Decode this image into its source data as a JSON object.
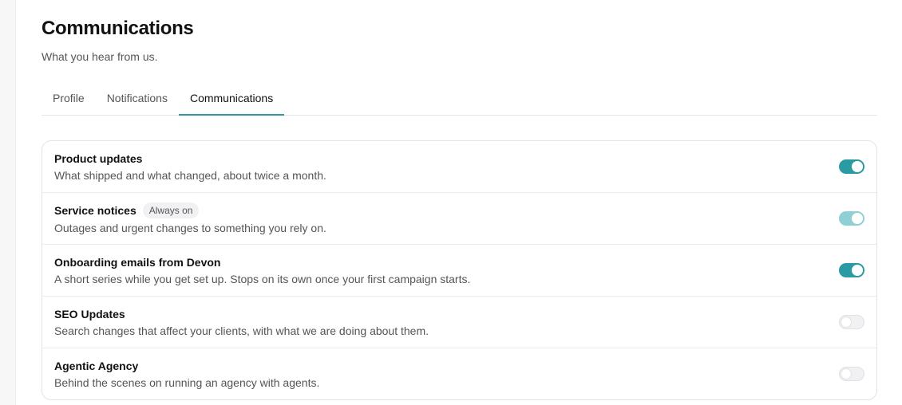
{
  "page": {
    "title": "Communications",
    "subtitle": "What you hear from us."
  },
  "tabs": [
    {
      "label": "Profile",
      "active": false
    },
    {
      "label": "Notifications",
      "active": false
    },
    {
      "label": "Communications",
      "active": true
    }
  ],
  "preferences": [
    {
      "title": "Product updates",
      "description": "What shipped and what changed, about twice a month.",
      "enabled": true,
      "locked": false
    },
    {
      "title": "Service notices",
      "badge": "Always on",
      "description": "Outages and urgent changes to something you rely on.",
      "enabled": true,
      "locked": true
    },
    {
      "title": "Onboarding emails from Devon",
      "description": "A short series while you get set up. Stops on its own once your first campaign starts.",
      "enabled": true,
      "locked": false
    },
    {
      "title": "SEO Updates",
      "description": "Search changes that affect your clients, with what we are doing about them.",
      "enabled": false,
      "locked": false
    },
    {
      "title": "Agentic Agency",
      "description": "Behind the scenes on running an agency with agents.",
      "enabled": false,
      "locked": false
    }
  ],
  "colors": {
    "accent": "#2a9aa3",
    "accent_locked": "#8fd0d4",
    "toggle_off": "#f1f1f3"
  }
}
